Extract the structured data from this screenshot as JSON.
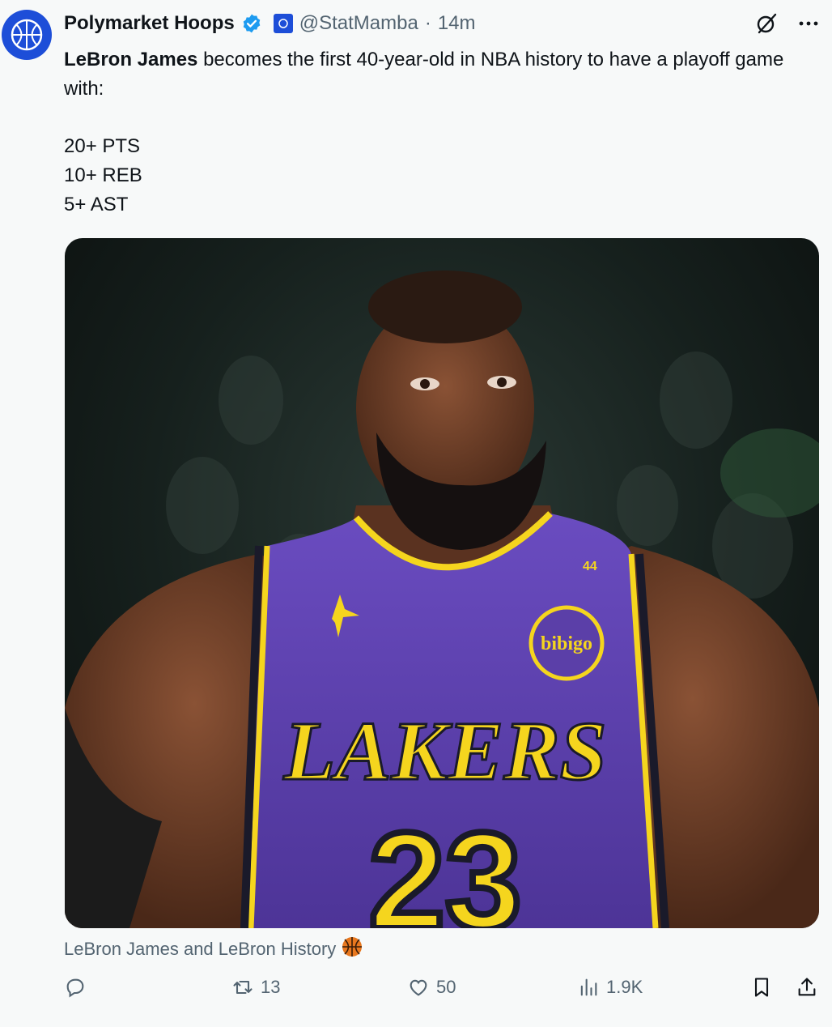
{
  "author": {
    "name": "Polymarket Hoops",
    "handle": "@StatMamba",
    "separator": "·",
    "time": "14m"
  },
  "tweet": {
    "mention": "LeBron James",
    "text_rest": " becomes the first 40-year-old in NBA history to have a playoff game with:",
    "stats": [
      "20+ PTS",
      "10+ REB",
      "5+ AST"
    ]
  },
  "media": {
    "jersey_wordmark": "LAKERS",
    "jersey_number": "23",
    "sponsor_patch": "bibigo",
    "strap_number": "44"
  },
  "caption": {
    "text": "LeBron James and LeBron History"
  },
  "actions": {
    "reply_count": "",
    "retweet_count": "13",
    "like_count": "50",
    "views_count": "1.9K"
  },
  "icons": {
    "verified": "verified-badge-icon",
    "grok": "grok-icon",
    "more": "more-icon",
    "reply": "reply-icon",
    "retweet": "retweet-icon",
    "like": "like-icon",
    "views": "views-icon",
    "bookmark": "bookmark-icon",
    "share": "share-icon",
    "basketball": "basketball-icon"
  },
  "colors": {
    "verified": "#1d9bf0",
    "avatar": "#1d4ed8",
    "muted": "#536471",
    "jersey_purple": "#5b3fa8",
    "jersey_gold": "#f5d51e"
  }
}
